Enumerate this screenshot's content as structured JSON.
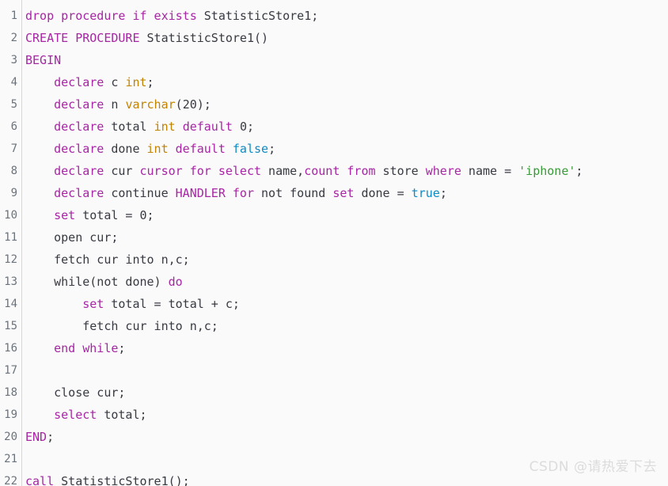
{
  "editor": {
    "language": "sql",
    "background_color": "#fafafa",
    "gutter_color": "#6a737d",
    "total_lines": 22,
    "colors": {
      "keyword": "#a626a4",
      "type": "#c18401",
      "string": "#3a9a3a",
      "boolean": "#0d8bc4",
      "plain": "#383a42",
      "line_number": "#6a737d",
      "divider": "#d8d8d8",
      "watermark": "#dcdcdc"
    }
  },
  "watermark": {
    "text": "CSDN @请热爱下去"
  },
  "lines": [
    {
      "number": "1",
      "plain_text": "drop procedure if exists StatisticStore1;",
      "tokens": [
        {
          "text": "drop procedure if exists",
          "cls": "k"
        },
        {
          "text": " StatisticStore1;",
          "cls": "p"
        }
      ]
    },
    {
      "number": "2",
      "plain_text": "CREATE PROCEDURE StatisticStore1()",
      "tokens": [
        {
          "text": "CREATE PROCEDURE",
          "cls": "k"
        },
        {
          "text": " StatisticStore1()",
          "cls": "p"
        }
      ]
    },
    {
      "number": "3",
      "plain_text": "BEGIN",
      "tokens": [
        {
          "text": "BEGIN",
          "cls": "k"
        }
      ]
    },
    {
      "number": "4",
      "plain_text": "    declare c int;",
      "tokens": [
        {
          "text": "    ",
          "cls": "p"
        },
        {
          "text": "declare",
          "cls": "k"
        },
        {
          "text": " c ",
          "cls": "p"
        },
        {
          "text": "int",
          "cls": "t"
        },
        {
          "text": ";",
          "cls": "p"
        }
      ]
    },
    {
      "number": "5",
      "plain_text": "    declare n varchar(20);",
      "tokens": [
        {
          "text": "    ",
          "cls": "p"
        },
        {
          "text": "declare",
          "cls": "k"
        },
        {
          "text": " n ",
          "cls": "p"
        },
        {
          "text": "varchar",
          "cls": "t"
        },
        {
          "text": "(",
          "cls": "p"
        },
        {
          "text": "20",
          "cls": "n"
        },
        {
          "text": ");",
          "cls": "p"
        }
      ]
    },
    {
      "number": "6",
      "plain_text": "    declare total int default 0;",
      "tokens": [
        {
          "text": "    ",
          "cls": "p"
        },
        {
          "text": "declare",
          "cls": "k"
        },
        {
          "text": " total ",
          "cls": "p"
        },
        {
          "text": "int",
          "cls": "t"
        },
        {
          "text": " ",
          "cls": "p"
        },
        {
          "text": "default",
          "cls": "k"
        },
        {
          "text": " ",
          "cls": "p"
        },
        {
          "text": "0",
          "cls": "n"
        },
        {
          "text": ";",
          "cls": "p"
        }
      ]
    },
    {
      "number": "7",
      "plain_text": "    declare done int default false;",
      "tokens": [
        {
          "text": "    ",
          "cls": "p"
        },
        {
          "text": "declare",
          "cls": "k"
        },
        {
          "text": " done ",
          "cls": "p"
        },
        {
          "text": "int",
          "cls": "t"
        },
        {
          "text": " ",
          "cls": "p"
        },
        {
          "text": "default",
          "cls": "k"
        },
        {
          "text": " ",
          "cls": "p"
        },
        {
          "text": "false",
          "cls": "b"
        },
        {
          "text": ";",
          "cls": "p"
        }
      ]
    },
    {
      "number": "8",
      "plain_text": "    declare cur cursor for select name,count from store where name = 'iphone';",
      "tokens": [
        {
          "text": "    ",
          "cls": "p"
        },
        {
          "text": "declare",
          "cls": "k"
        },
        {
          "text": " cur ",
          "cls": "p"
        },
        {
          "text": "cursor for select",
          "cls": "k"
        },
        {
          "text": " name,",
          "cls": "p"
        },
        {
          "text": "count",
          "cls": "k"
        },
        {
          "text": " ",
          "cls": "p"
        },
        {
          "text": "from",
          "cls": "k"
        },
        {
          "text": " store ",
          "cls": "p"
        },
        {
          "text": "where",
          "cls": "k"
        },
        {
          "text": " name = ",
          "cls": "p"
        },
        {
          "text": "'iphone'",
          "cls": "s"
        },
        {
          "text": ";",
          "cls": "p"
        }
      ]
    },
    {
      "number": "9",
      "plain_text": "    declare continue HANDLER for not found set done = true;",
      "tokens": [
        {
          "text": "    ",
          "cls": "p"
        },
        {
          "text": "declare",
          "cls": "k"
        },
        {
          "text": " continue ",
          "cls": "p"
        },
        {
          "text": "HANDLER for",
          "cls": "k"
        },
        {
          "text": " not found ",
          "cls": "p"
        },
        {
          "text": "set",
          "cls": "k"
        },
        {
          "text": " done = ",
          "cls": "p"
        },
        {
          "text": "true",
          "cls": "b"
        },
        {
          "text": ";",
          "cls": "p"
        }
      ]
    },
    {
      "number": "10",
      "plain_text": "    set total = 0;",
      "tokens": [
        {
          "text": "    ",
          "cls": "p"
        },
        {
          "text": "set",
          "cls": "k"
        },
        {
          "text": " total = ",
          "cls": "p"
        },
        {
          "text": "0",
          "cls": "n"
        },
        {
          "text": ";",
          "cls": "p"
        }
      ]
    },
    {
      "number": "11",
      "plain_text": "    open cur;",
      "tokens": [
        {
          "text": "    open cur;",
          "cls": "p"
        }
      ]
    },
    {
      "number": "12",
      "plain_text": "    fetch cur into n,c;",
      "tokens": [
        {
          "text": "    fetch cur into n,c;",
          "cls": "p"
        }
      ]
    },
    {
      "number": "13",
      "plain_text": "    while(not done) do",
      "tokens": [
        {
          "text": "    while(not done) ",
          "cls": "p"
        },
        {
          "text": "do",
          "cls": "k"
        }
      ]
    },
    {
      "number": "14",
      "plain_text": "        set total = total + c;",
      "tokens": [
        {
          "text": "        ",
          "cls": "p"
        },
        {
          "text": "set",
          "cls": "k"
        },
        {
          "text": " total = total + c;",
          "cls": "p"
        }
      ]
    },
    {
      "number": "15",
      "plain_text": "        fetch cur into n,c;",
      "tokens": [
        {
          "text": "        fetch cur into n,c;",
          "cls": "p"
        }
      ]
    },
    {
      "number": "16",
      "plain_text": "    end while;",
      "tokens": [
        {
          "text": "    ",
          "cls": "p"
        },
        {
          "text": "end while",
          "cls": "k"
        },
        {
          "text": ";",
          "cls": "p"
        }
      ]
    },
    {
      "number": "17",
      "plain_text": "",
      "tokens": []
    },
    {
      "number": "18",
      "plain_text": "    close cur;",
      "tokens": [
        {
          "text": "    close cur;",
          "cls": "p"
        }
      ]
    },
    {
      "number": "19",
      "plain_text": "    select total;",
      "tokens": [
        {
          "text": "    ",
          "cls": "p"
        },
        {
          "text": "select",
          "cls": "k"
        },
        {
          "text": " total;",
          "cls": "p"
        }
      ]
    },
    {
      "number": "20",
      "plain_text": "END;",
      "tokens": [
        {
          "text": "END",
          "cls": "k"
        },
        {
          "text": ";",
          "cls": "p"
        }
      ]
    },
    {
      "number": "21",
      "plain_text": "",
      "tokens": []
    },
    {
      "number": "22",
      "plain_text": "call StatisticStore1();",
      "tokens": [
        {
          "text": "call",
          "cls": "k"
        },
        {
          "text": " StatisticStore1();",
          "cls": "p"
        }
      ]
    }
  ]
}
